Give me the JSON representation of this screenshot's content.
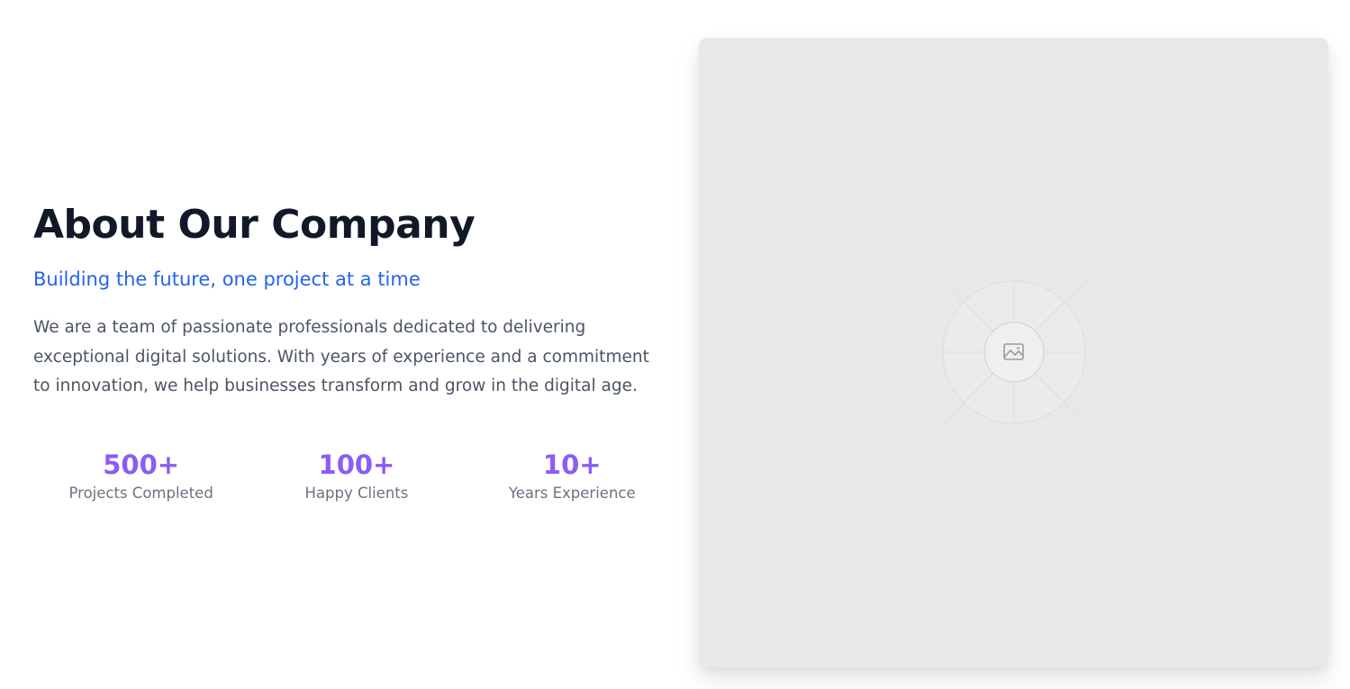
{
  "about": {
    "title": "About Our Company",
    "subtitle": "Building the future, one project at a time",
    "description": "We are a team of passionate professionals dedicated to delivering exceptional digital solutions. With years of experience and a commitment to innovation, we help businesses transform and grow in the digital age."
  },
  "stats": [
    {
      "value": "500+",
      "label": "Projects Completed"
    },
    {
      "value": "100+",
      "label": "Happy Clients"
    },
    {
      "value": "10+",
      "label": "Years Experience"
    }
  ],
  "image": {
    "icon": "image-icon",
    "background": "#e8e8e8"
  },
  "colors": {
    "title": "#111827",
    "accent_blue": "#2563eb",
    "accent_purple": "#8b5cf6",
    "body_text": "#4b5563",
    "muted_text": "#6b7280"
  }
}
